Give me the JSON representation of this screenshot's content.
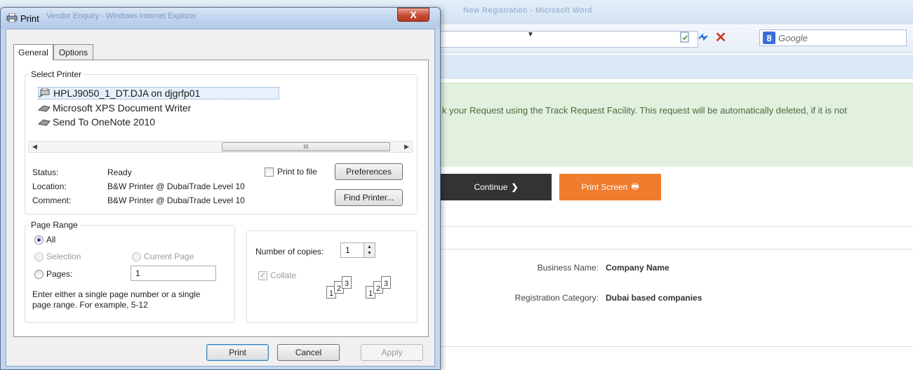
{
  "background": {
    "browser_title_blur": "Vendor Enquiry - Windows Internet Explorer",
    "word_title_blur": "New Registration - Microsoft Word",
    "search": {
      "engine_badge": "8",
      "placeholder": "Google"
    },
    "notice_text": "k your Request using the Track Request Facility. This request will be automatically deleted, if it is not",
    "continue_label": "Continue",
    "continue_icon": "❯",
    "print_screen_label": "Print Screen",
    "print_screen_icon": "🖶",
    "details": [
      {
        "label": "Business Name:",
        "value": "Company Name"
      },
      {
        "label": "Registration Category:",
        "value": "Dubai based companies"
      }
    ]
  },
  "dialog": {
    "title": "Print",
    "close_glyph": "X",
    "tabs": [
      "General",
      "Options"
    ],
    "select_printer": {
      "legend": "Select Printer",
      "printers": [
        {
          "name": "HPLJ9050_1_DT.DJA on djgrfp01",
          "selected": true
        },
        {
          "name": "Microsoft XPS Document Writer",
          "selected": false
        },
        {
          "name": "Send To OneNote 2010",
          "selected": false
        }
      ],
      "scroll_thumb": "III",
      "status_label": "Status:",
      "status_value": "Ready",
      "location_label": "Location:",
      "location_value": "B&W Printer @ DubaiTrade Level 10",
      "comment_label": "Comment:",
      "comment_value": "B&W Printer @ DubaiTrade Level 10",
      "print_to_file": "Print to file",
      "preferences_button": "Preferences",
      "find_printer_button": "Find Printer..."
    },
    "page_range": {
      "legend": "Page Range",
      "all": "All",
      "selection": "Selection",
      "current_page": "Current Page",
      "pages": "Pages:",
      "pages_value": "1",
      "hint_line1": "Enter either a single page number or a single",
      "hint_line2": "page range.  For example, 5-12"
    },
    "copies": {
      "label": "Number of copies:",
      "value": "1",
      "collate": "Collate",
      "collate_pages": [
        "1",
        "2",
        "3"
      ]
    },
    "footer": {
      "print": "Print",
      "cancel": "Cancel",
      "apply": "Apply"
    }
  }
}
